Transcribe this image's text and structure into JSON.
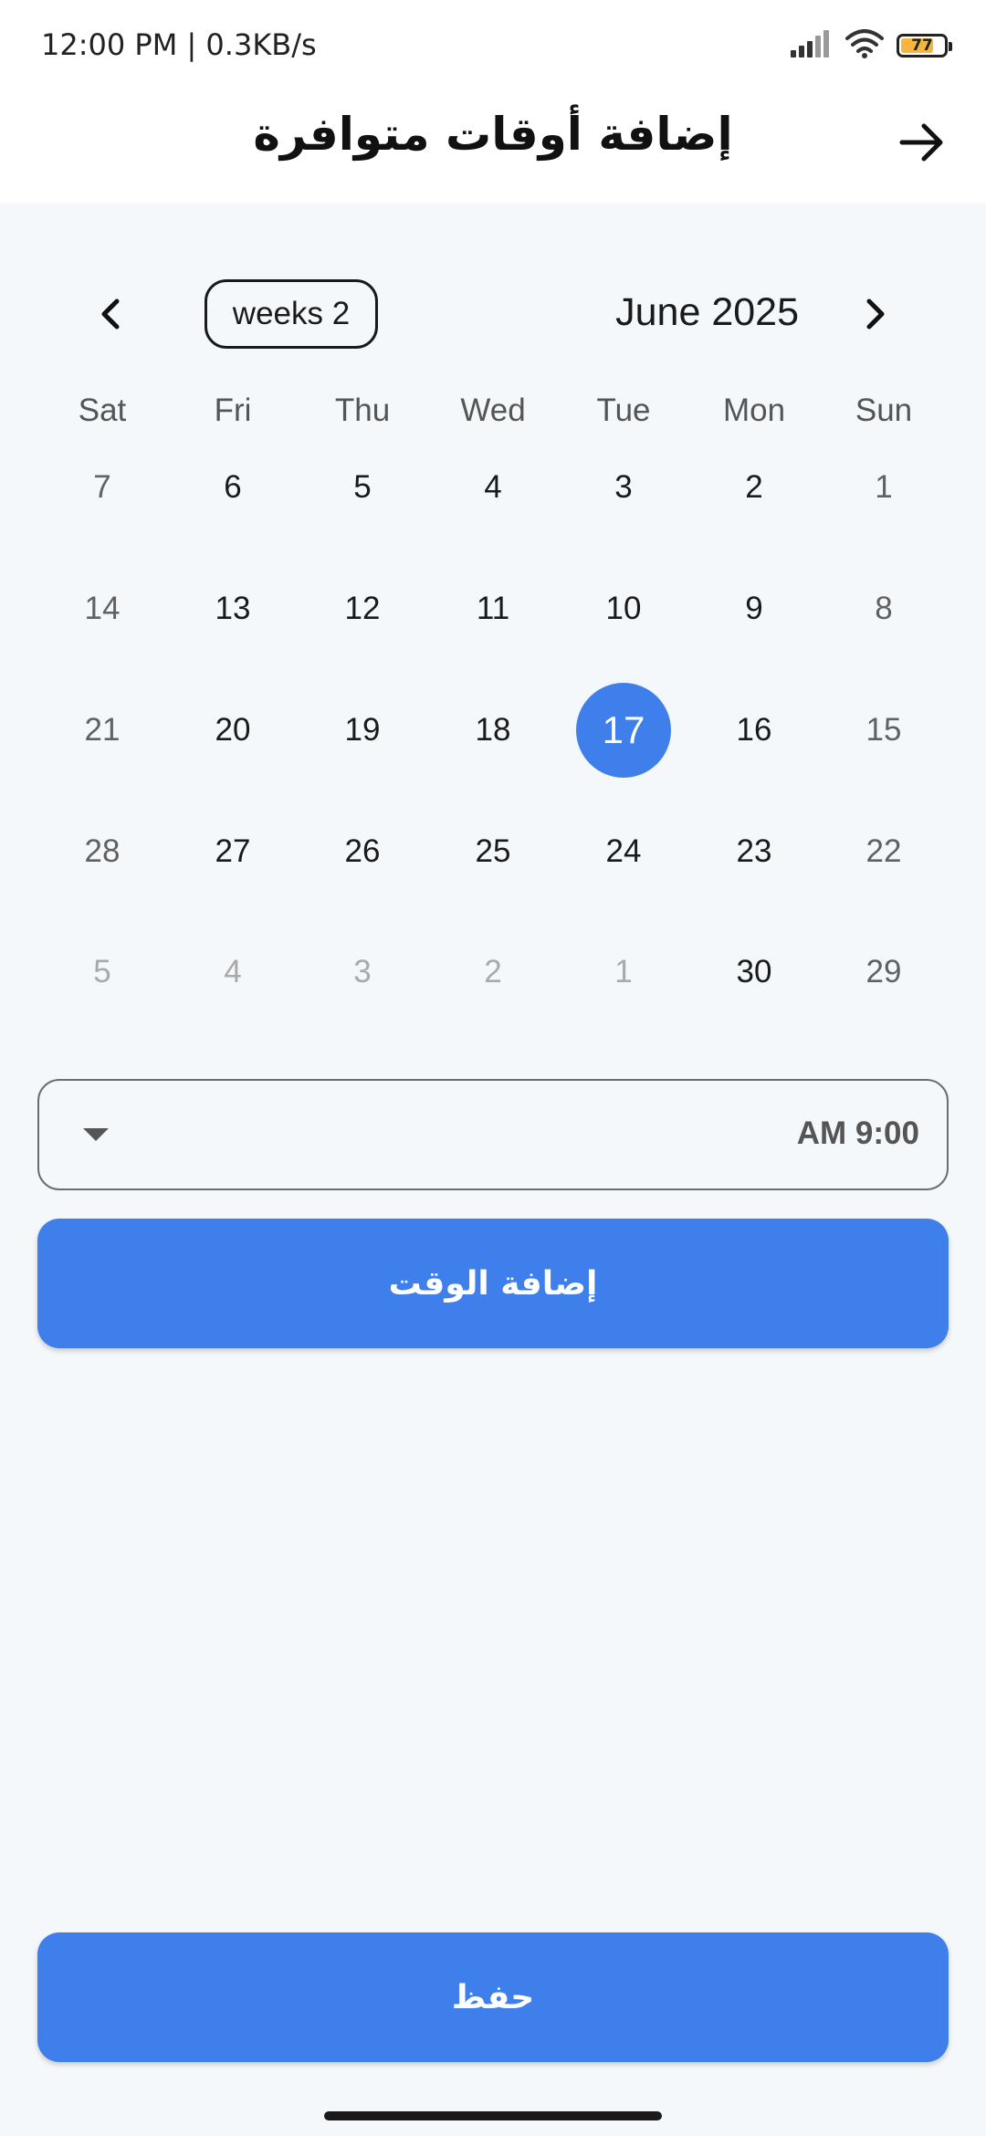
{
  "status_bar": {
    "time_speed": "12:00 PM | 0.3KB/s",
    "battery_level": "77",
    "battery_color": "#f4b63f",
    "icons": [
      "signal-icon",
      "wifi-icon",
      "battery-icon"
    ]
  },
  "app_bar": {
    "title": "إضافة أوقات متوافرة",
    "back_icon": "arrow-right-icon"
  },
  "calendar": {
    "prev_icon": "chevron-left-icon",
    "next_icon": "chevron-right-icon",
    "format_chip": "weeks 2",
    "month_title": "June 2025",
    "weekdays": [
      "Sat",
      "Fri",
      "Thu",
      "Wed",
      "Tue",
      "Mon",
      "Sun"
    ],
    "weeks": [
      [
        "7",
        "6",
        "5",
        "4",
        "3",
        "2",
        "1"
      ],
      [
        "14",
        "13",
        "12",
        "11",
        "10",
        "9",
        "8"
      ],
      [
        "21",
        "20",
        "19",
        "18",
        "17",
        "16",
        "15"
      ],
      [
        "28",
        "27",
        "26",
        "25",
        "24",
        "23",
        "22"
      ],
      [
        "5",
        "4",
        "3",
        "2",
        "1",
        "30",
        "29"
      ]
    ],
    "selected_day": "17",
    "selected_color": "#3e7fec"
  },
  "time_picker": {
    "selected_value": "AM 9:00",
    "icon": "dropdown-arrow-icon"
  },
  "add_time_button": {
    "label": "إضافة الوقت"
  },
  "save_button": {
    "label": "حفظ"
  }
}
